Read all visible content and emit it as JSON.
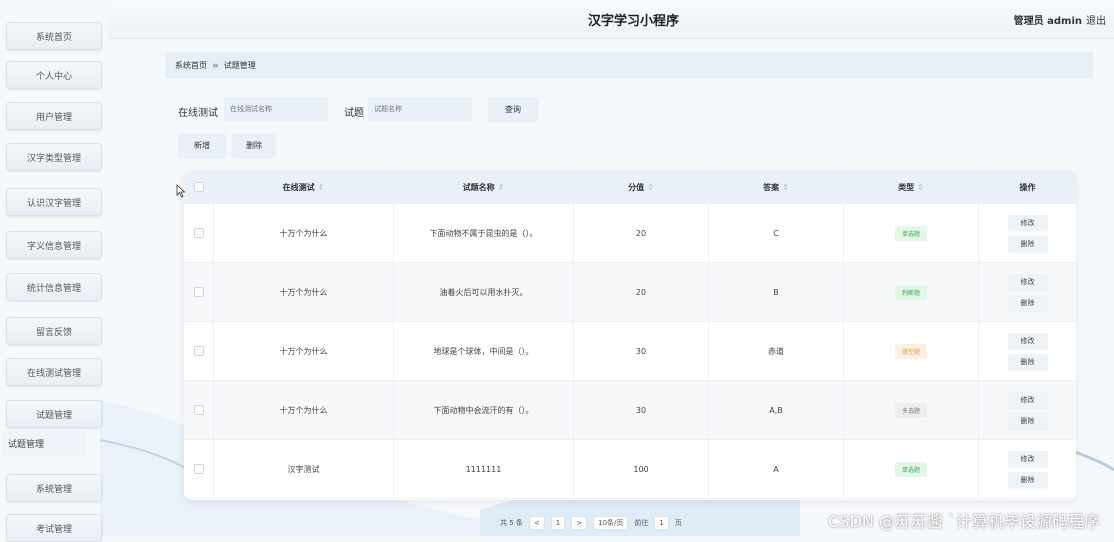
{
  "sidebar": {
    "items": [
      {
        "label": "系统首页"
      },
      {
        "label": "个人中心"
      },
      {
        "label": "用户管理"
      },
      {
        "label": "汉字类型管理"
      },
      {
        "label": "认识汉字管理"
      },
      {
        "label": "字义信息管理"
      },
      {
        "label": "统计信息管理"
      },
      {
        "label": "留言反馈"
      },
      {
        "label": "在线测试管理"
      },
      {
        "label": "试题管理"
      },
      {
        "label": "系统管理"
      },
      {
        "label": "考试管理"
      }
    ],
    "sub_item": "试题管理"
  },
  "header": {
    "title": "汉字学习小程序",
    "user": "管理员 admin",
    "logout": "退出"
  },
  "breadcrumb": {
    "home": "系统首页",
    "separator": "≡",
    "current": "试题管理"
  },
  "search": {
    "test_label": "在线测试",
    "test_placeholder": "在线测试名称",
    "question_label": "试题",
    "question_placeholder": "试题名称",
    "query_button": "查询"
  },
  "toolbar": {
    "add": "新增",
    "delete": "删除"
  },
  "table": {
    "headers": [
      "在线测试",
      "试题名称",
      "分值",
      "答案",
      "类型",
      "操作"
    ],
    "sort_icon": "⇕",
    "rows": [
      {
        "test": "十万个为什么",
        "question": "下面动物不属于昆虫的是（）。",
        "score": "20",
        "answer": "C",
        "type": "单选题",
        "type_color": "#e3f6e8",
        "type_text_color": "#3aa85d"
      },
      {
        "test": "十万个为什么",
        "question": "油着火后可以用水扑灭。",
        "score": "20",
        "answer": "B",
        "type": "判断题",
        "type_color": "#e3f6e8",
        "type_text_color": "#3aa85d"
      },
      {
        "test": "十万个为什么",
        "question": "地球是个球体，中间是（）。",
        "score": "30",
        "answer": "赤道",
        "type": "填空题",
        "type_color": "#fdf0e2",
        "type_text_color": "#e8963a"
      },
      {
        "test": "十万个为什么",
        "question": "下面动物中会流汗的有（）。",
        "score": "30",
        "answer": "A,B",
        "type": "多选题",
        "type_color": "#eeeeee",
        "type_text_color": "#777777"
      },
      {
        "test": "汉字测试",
        "question": "1111111",
        "score": "100",
        "answer": "A",
        "type": "单选题",
        "type_color": "#e3f6e8",
        "type_text_color": "#3aa85d"
      }
    ],
    "edit": "修改",
    "remove": "删除"
  },
  "pagination": {
    "total": "共 5 条",
    "prev": "<",
    "page": "1",
    "next": ">",
    "page_size": "10条/页",
    "goto_label": "前往",
    "goto_value": "1",
    "page_unit": "页"
  },
  "watermark": "CSDN @苏苏酱 `计算机毕设源码程序"
}
